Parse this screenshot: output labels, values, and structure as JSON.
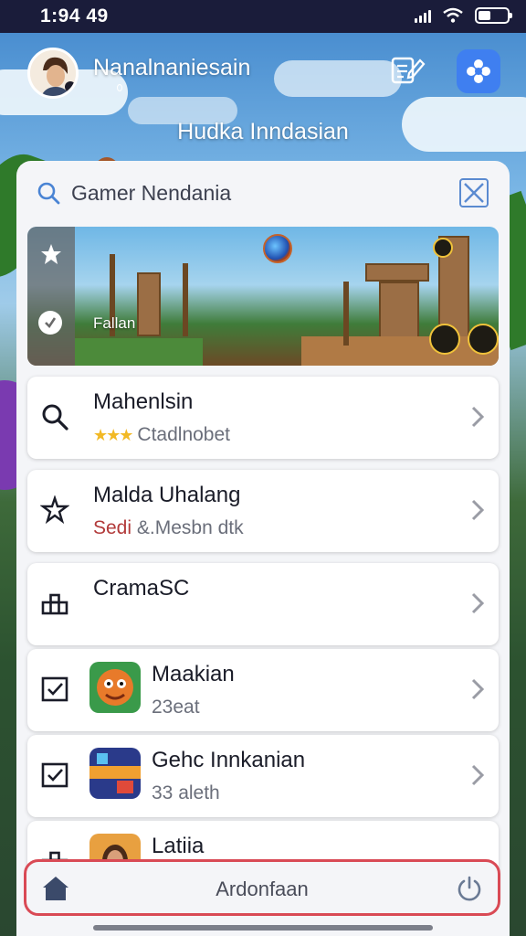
{
  "status_bar": {
    "time": "1:94 49"
  },
  "header": {
    "username": "Nanalnaniesain",
    "subtitle": "Hudka Inndasian",
    "notes_icon": "notes-edit-icon",
    "app_icon": "flower-app-icon"
  },
  "search": {
    "text": "Gamer Nendania",
    "close_icon": "close-icon"
  },
  "banner": {
    "label": "Fallan",
    "side_icons": [
      "star-icon",
      "check-circle-icon"
    ]
  },
  "list": [
    {
      "title": "Mahenlsin",
      "subtitle": "Ctadlnobet",
      "icon": "search-icon",
      "stars": "★★★"
    },
    {
      "title": "Malda Uhalang",
      "subtitle_red": "Sedi",
      "subtitle": "&.Mesbn dtk",
      "icon": "puzzle-star-icon"
    },
    {
      "title": "CramaSC",
      "subtitle": "",
      "icon": "podium-icon"
    },
    {
      "title": "Maakian",
      "subtitle": "23eat",
      "icon": "checkbox-icon",
      "thumb": "monster-thumb"
    },
    {
      "title": "Gehc Innkanian",
      "subtitle": "33 aleth",
      "icon": "checkbox-icon",
      "thumb": "arcade-thumb"
    },
    {
      "title": "Latiia",
      "subtitle": "",
      "icon": "podium-icon",
      "thumb": "portrait-thumb"
    }
  ],
  "bottom_nav": {
    "label": "Ardonfaan",
    "home_icon": "home-icon",
    "power_icon": "power-icon"
  },
  "colors": {
    "accent_blue": "#3f7ff0",
    "nav_border": "#d94a55",
    "star": "#f2b925",
    "panel": "#f4f5f8"
  }
}
